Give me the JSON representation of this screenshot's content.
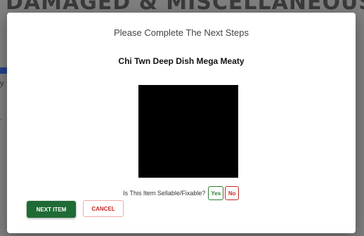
{
  "background": {
    "heading": "DAMAGED & MISCELLANEOUS ITEMS",
    "marks": [
      "y",
      "."
    ]
  },
  "dialog": {
    "title": "Please Complete The Next Steps",
    "item_name": "Chi Twn Deep Dish Mega Meaty",
    "question": "Is This Item Sellable/Fixable?",
    "yes_label": "Yes",
    "no_label": "No",
    "next_label": "NEXT ITEM",
    "cancel_label": "CANCEL"
  },
  "colors": {
    "next_button": "#1f6b35",
    "yes": "#2e7d32",
    "no": "#c62828",
    "overlay": "#7f7f7f"
  }
}
